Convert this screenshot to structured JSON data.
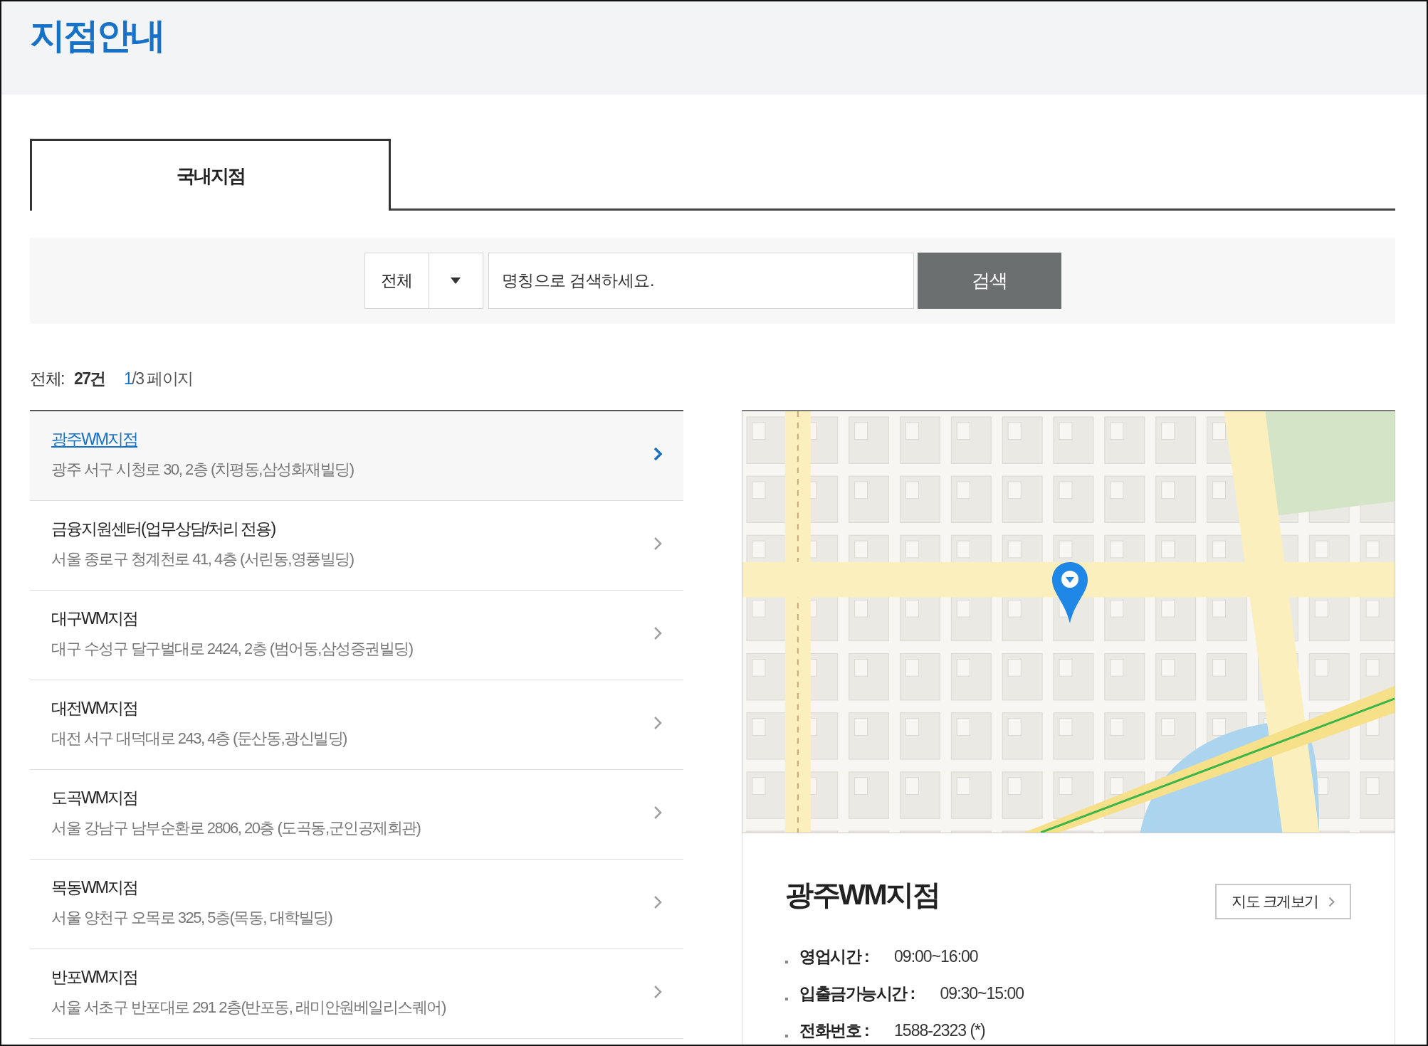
{
  "page_title": "지점안내",
  "tabs": [
    {
      "label": "국내지점",
      "selected": true
    }
  ],
  "search": {
    "category": "전체",
    "placeholder": "명칭으로 검색하세요.",
    "button": "검색"
  },
  "summary": {
    "total_label": "전체:",
    "total_count": "27건",
    "current_page": "1",
    "page_total": "/3 페이지"
  },
  "branches": [
    {
      "name": "광주WM지점",
      "address": "광주 서구 시청로 30, 2층 (치평동,삼성화재빌딩)",
      "selected": true
    },
    {
      "name": "금융지원센터(업무상담/처리 전용)",
      "address": "서울 종로구 청계천로 41, 4층 (서린동,영풍빌딩)",
      "selected": false
    },
    {
      "name": "대구WM지점",
      "address": "대구 수성구 달구벌대로 2424, 2층 (범어동,삼성증권빌딩)",
      "selected": false
    },
    {
      "name": "대전WM지점",
      "address": "대전 서구 대덕대로 243, 4층 (둔산동,광신빌딩)",
      "selected": false
    },
    {
      "name": "도곡WM지점",
      "address": "서울 강남구 남부순환로 2806, 20층 (도곡동,군인공제회관)",
      "selected": false
    },
    {
      "name": "목동WM지점",
      "address": "서울 양천구 오목로 325, 5층(목동, 대학빌딩)",
      "selected": false
    },
    {
      "name": "반포WM지점",
      "address": "서울 서초구 반포대로 291 2층(반포동, 래미안원베일리스퀘어)",
      "selected": false
    }
  ],
  "detail": {
    "name": "광주WM지점",
    "map_button": "지도 크게보기",
    "info": [
      {
        "label": "영업시간 :",
        "value": "09:00~16:00"
      },
      {
        "label": "입출금가능시간 :",
        "value": "09:30~15:00"
      },
      {
        "label": "전화번호 :",
        "value": "1588-2323 (*)"
      }
    ]
  }
}
